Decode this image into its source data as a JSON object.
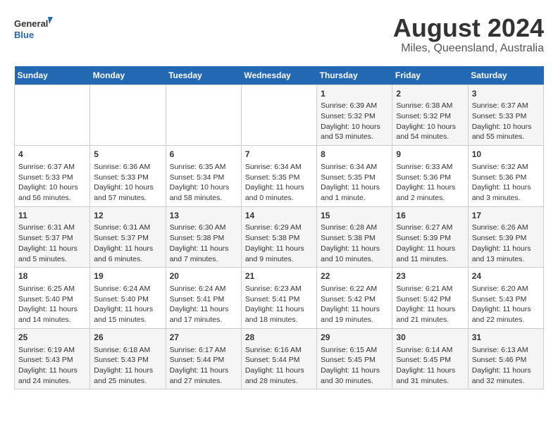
{
  "logo": {
    "line1": "General",
    "line2": "Blue"
  },
  "title": "August 2024",
  "subtitle": "Miles, Queensland, Australia",
  "days_of_week": [
    "Sunday",
    "Monday",
    "Tuesday",
    "Wednesday",
    "Thursday",
    "Friday",
    "Saturday"
  ],
  "weeks": [
    [
      {
        "day": "",
        "text": ""
      },
      {
        "day": "",
        "text": ""
      },
      {
        "day": "",
        "text": ""
      },
      {
        "day": "",
        "text": ""
      },
      {
        "day": "1",
        "text": "Sunrise: 6:39 AM\nSunset: 5:32 PM\nDaylight: 10 hours and 53 minutes."
      },
      {
        "day": "2",
        "text": "Sunrise: 6:38 AM\nSunset: 5:32 PM\nDaylight: 10 hours and 54 minutes."
      },
      {
        "day": "3",
        "text": "Sunrise: 6:37 AM\nSunset: 5:33 PM\nDaylight: 10 hours and 55 minutes."
      }
    ],
    [
      {
        "day": "4",
        "text": "Sunrise: 6:37 AM\nSunset: 5:33 PM\nDaylight: 10 hours and 56 minutes."
      },
      {
        "day": "5",
        "text": "Sunrise: 6:36 AM\nSunset: 5:33 PM\nDaylight: 10 hours and 57 minutes."
      },
      {
        "day": "6",
        "text": "Sunrise: 6:35 AM\nSunset: 5:34 PM\nDaylight: 10 hours and 58 minutes."
      },
      {
        "day": "7",
        "text": "Sunrise: 6:34 AM\nSunset: 5:35 PM\nDaylight: 11 hours and 0 minutes."
      },
      {
        "day": "8",
        "text": "Sunrise: 6:34 AM\nSunset: 5:35 PM\nDaylight: 11 hours and 1 minute."
      },
      {
        "day": "9",
        "text": "Sunrise: 6:33 AM\nSunset: 5:36 PM\nDaylight: 11 hours and 2 minutes."
      },
      {
        "day": "10",
        "text": "Sunrise: 6:32 AM\nSunset: 5:36 PM\nDaylight: 11 hours and 3 minutes."
      }
    ],
    [
      {
        "day": "11",
        "text": "Sunrise: 6:31 AM\nSunset: 5:37 PM\nDaylight: 11 hours and 5 minutes."
      },
      {
        "day": "12",
        "text": "Sunrise: 6:31 AM\nSunset: 5:37 PM\nDaylight: 11 hours and 6 minutes."
      },
      {
        "day": "13",
        "text": "Sunrise: 6:30 AM\nSunset: 5:38 PM\nDaylight: 11 hours and 7 minutes."
      },
      {
        "day": "14",
        "text": "Sunrise: 6:29 AM\nSunset: 5:38 PM\nDaylight: 11 hours and 9 minutes."
      },
      {
        "day": "15",
        "text": "Sunrise: 6:28 AM\nSunset: 5:38 PM\nDaylight: 11 hours and 10 minutes."
      },
      {
        "day": "16",
        "text": "Sunrise: 6:27 AM\nSunset: 5:39 PM\nDaylight: 11 hours and 11 minutes."
      },
      {
        "day": "17",
        "text": "Sunrise: 6:26 AM\nSunset: 5:39 PM\nDaylight: 11 hours and 13 minutes."
      }
    ],
    [
      {
        "day": "18",
        "text": "Sunrise: 6:25 AM\nSunset: 5:40 PM\nDaylight: 11 hours and 14 minutes."
      },
      {
        "day": "19",
        "text": "Sunrise: 6:24 AM\nSunset: 5:40 PM\nDaylight: 11 hours and 15 minutes."
      },
      {
        "day": "20",
        "text": "Sunrise: 6:24 AM\nSunset: 5:41 PM\nDaylight: 11 hours and 17 minutes."
      },
      {
        "day": "21",
        "text": "Sunrise: 6:23 AM\nSunset: 5:41 PM\nDaylight: 11 hours and 18 minutes."
      },
      {
        "day": "22",
        "text": "Sunrise: 6:22 AM\nSunset: 5:42 PM\nDaylight: 11 hours and 19 minutes."
      },
      {
        "day": "23",
        "text": "Sunrise: 6:21 AM\nSunset: 5:42 PM\nDaylight: 11 hours and 21 minutes."
      },
      {
        "day": "24",
        "text": "Sunrise: 6:20 AM\nSunset: 5:43 PM\nDaylight: 11 hours and 22 minutes."
      }
    ],
    [
      {
        "day": "25",
        "text": "Sunrise: 6:19 AM\nSunset: 5:43 PM\nDaylight: 11 hours and 24 minutes."
      },
      {
        "day": "26",
        "text": "Sunrise: 6:18 AM\nSunset: 5:43 PM\nDaylight: 11 hours and 25 minutes."
      },
      {
        "day": "27",
        "text": "Sunrise: 6:17 AM\nSunset: 5:44 PM\nDaylight: 11 hours and 27 minutes."
      },
      {
        "day": "28",
        "text": "Sunrise: 6:16 AM\nSunset: 5:44 PM\nDaylight: 11 hours and 28 minutes."
      },
      {
        "day": "29",
        "text": "Sunrise: 6:15 AM\nSunset: 5:45 PM\nDaylight: 11 hours and 30 minutes."
      },
      {
        "day": "30",
        "text": "Sunrise: 6:14 AM\nSunset: 5:45 PM\nDaylight: 11 hours and 31 minutes."
      },
      {
        "day": "31",
        "text": "Sunrise: 6:13 AM\nSunset: 5:46 PM\nDaylight: 11 hours and 32 minutes."
      }
    ]
  ]
}
